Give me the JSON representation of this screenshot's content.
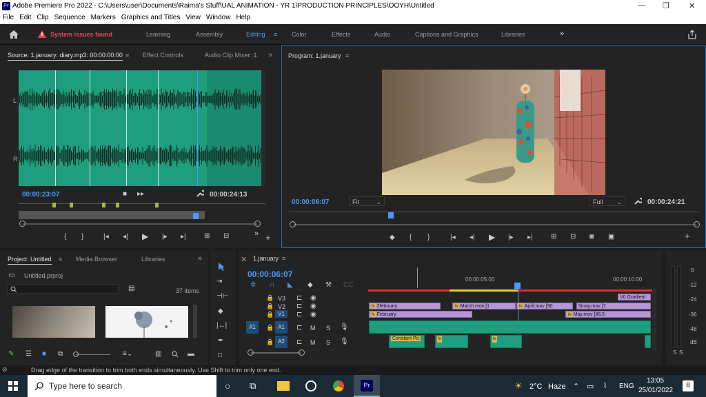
{
  "window": {
    "app_icon": "Pr",
    "title": "Adobe Premiere Pro 2022 - C:\\Users\\user\\Documents\\Raima's Stuff\\UAL ANIMATION - YR 1\\PRODUCTION PRINCIPLES\\OOYH\\Untitled",
    "minimize": "—",
    "maximize": "❐",
    "close": "✕"
  },
  "menu": [
    "File",
    "Edit",
    "Clip",
    "Sequence",
    "Markers",
    "Graphics and Titles",
    "View",
    "Window",
    "Help"
  ],
  "workspace": {
    "warning": "System issues found",
    "tabs": [
      "Learning",
      "Assembly",
      "Editing",
      "Color",
      "Effects",
      "Audio",
      "Captions and Graphics",
      "Libraries"
    ],
    "active": "Editing",
    "more": "»"
  },
  "source": {
    "tab_source": "Source: 1.january: diary.mp3: 00:00:00:00",
    "tab_effects": "Effect Controls",
    "tab_mixer": "Audio Clip Mixer: 1.",
    "ch_L": "L",
    "ch_R": "R",
    "in_tc": "00:00:23:07",
    "dur_tc": "00:00:24:13"
  },
  "program": {
    "tab": "Program: 1.january",
    "tc": "00:00:06:07",
    "fit": "Fit",
    "quality": "Full",
    "dur_tc": "00:00:24:21"
  },
  "project": {
    "tab_project": "Project: Untitled",
    "tab_media": "Media Browser",
    "tab_libraries": "Libraries",
    "file": "Untitled.prproj",
    "items": "37 items"
  },
  "timeline": {
    "tab": "1.january",
    "tc": "00:00:06:07",
    "ruler": [
      "00:00:05:00",
      "00:00:10:00"
    ],
    "tracks": {
      "v3": "V3",
      "v2": "V2",
      "v1": "V1",
      "a1": "A1",
      "a2": "A2",
      "m": "M",
      "s": "S"
    },
    "clips": {
      "c1": "2february",
      "c2": "March.mov [1",
      "c3": "April.mov [90",
      "c4": "5may.mov [7",
      "c5": "February.",
      "c6": "May.mov [86.5",
      "c7": "V0 Gradient",
      "c8": "Constant Po"
    }
  },
  "meter": {
    "labels": [
      "0",
      "-12",
      "-24",
      "-36",
      "-48",
      "dB"
    ],
    "s1": "S",
    "s2": "S"
  },
  "status": "Drag edge of the transition to trim both ends simultaneously. Use Shift to trim only one end.",
  "taskbar": {
    "search": "Type here to search",
    "temp": "2°C",
    "weather": "Haze",
    "lang": "ENG",
    "time": "13:05",
    "date": "25/01/2022",
    "notif": "8"
  },
  "colors": {
    "accent": "#4a9bf5",
    "waveform_bg": "#1f9e7f",
    "video_clip": "#b596d6",
    "warning": "#e34850"
  }
}
